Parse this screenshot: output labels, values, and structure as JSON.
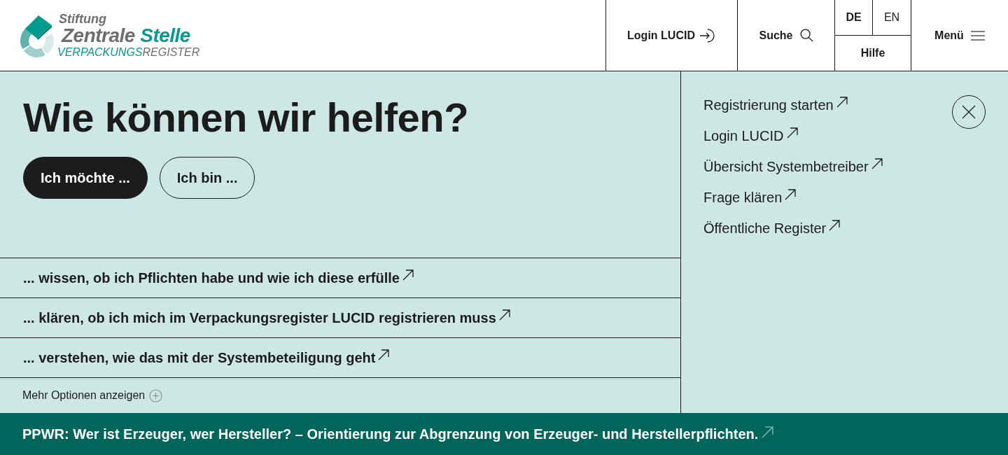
{
  "logo": {
    "overline": "Stiftung",
    "title": [
      "Zentrale",
      "Stelle"
    ],
    "subtitle": [
      "VERPACKUNGS",
      "REGISTER"
    ]
  },
  "header": {
    "login": "Login LUCID",
    "search": "Suche",
    "languages": [
      {
        "label": "DE",
        "selected": true
      },
      {
        "label": "EN",
        "selected": false
      }
    ],
    "help": "Hilfe",
    "menu": "Menü"
  },
  "help": {
    "heading": "Wie können wir helfen?",
    "tabs": [
      {
        "label": "Ich möchte ...",
        "selected": true
      },
      {
        "label": "Ich bin ...",
        "selected": false
      }
    ],
    "options": [
      "... wissen, ob ich Pflichten habe und wie ich diese erfülle",
      "... klären, ob ich mich im Verpackungsregister LUCID registrieren muss",
      "... verstehen, wie das mit der Systembeteiligung geht"
    ],
    "more_options": "Mehr Optionen anzeigen"
  },
  "quick_links": [
    "Registrierung starten",
    "Login LUCID",
    "Übersicht Systembetreiber",
    "Frage klären",
    "Öffentliche Register"
  ],
  "banner": "PPWR: Wer ist Erzeuger, wer Hersteller? – Orientierung zur Abgrenzung von Erzeuger- und Herstellerpflichten."
}
